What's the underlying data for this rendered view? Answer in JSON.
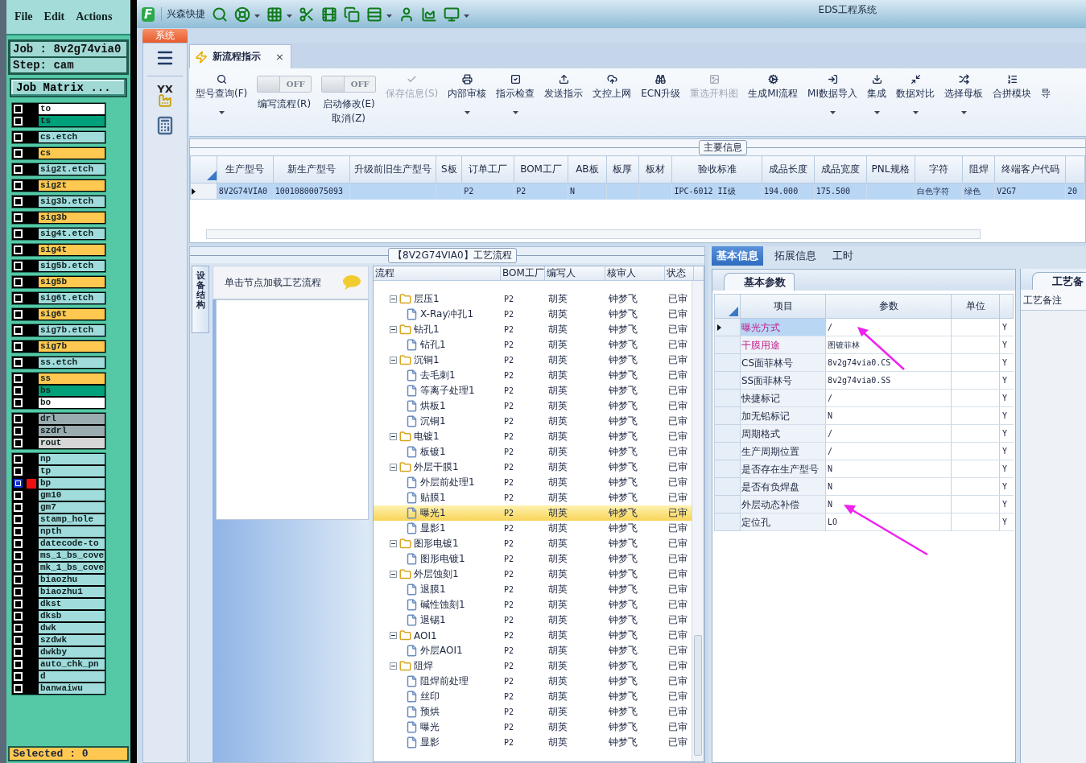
{
  "left_panel": {
    "menu": [
      "File",
      "Edit",
      "Actions"
    ],
    "job": "Job : 8v2g74via0",
    "step": "Step: cam",
    "matrix_button": "Job Matrix ...",
    "layer_groups": [
      {
        "layers": [
          {
            "name": "to",
            "color": "#ffffff",
            "selected": false
          },
          {
            "name": "ts",
            "color": "#00a07a",
            "selected": false
          }
        ]
      },
      {
        "layers": [
          {
            "name": "cs.etch",
            "color": "#a0dcdc",
            "selected": false
          }
        ]
      },
      {
        "layers": [
          {
            "name": "cs",
            "color": "#ffc850",
            "selected": false
          }
        ]
      },
      {
        "layers": [
          {
            "name": "sig2t.etch",
            "color": "#a0dcdc",
            "selected": false
          }
        ]
      },
      {
        "layers": [
          {
            "name": "sig2t",
            "color": "#ffc850",
            "selected": false
          }
        ]
      },
      {
        "layers": [
          {
            "name": "sig3b.etch",
            "color": "#a0dcdc",
            "selected": false
          }
        ]
      },
      {
        "layers": [
          {
            "name": "sig3b",
            "color": "#ffc850",
            "selected": false
          }
        ]
      },
      {
        "layers": [
          {
            "name": "sig4t.etch",
            "color": "#a0dcdc",
            "selected": false
          }
        ]
      },
      {
        "layers": [
          {
            "name": "sig4t",
            "color": "#ffc850",
            "selected": false
          }
        ]
      },
      {
        "layers": [
          {
            "name": "sig5b.etch",
            "color": "#a0dcdc",
            "selected": false
          }
        ]
      },
      {
        "layers": [
          {
            "name": "sig5b",
            "color": "#ffc850",
            "selected": false
          }
        ]
      },
      {
        "layers": [
          {
            "name": "sig6t.etch",
            "color": "#a0dcdc",
            "selected": false
          }
        ]
      },
      {
        "layers": [
          {
            "name": "sig6t",
            "color": "#ffc850",
            "selected": false
          }
        ]
      },
      {
        "layers": [
          {
            "name": "sig7b.etch",
            "color": "#a0dcdc",
            "selected": false
          }
        ]
      },
      {
        "layers": [
          {
            "name": "sig7b",
            "color": "#ffc850",
            "selected": false
          }
        ]
      },
      {
        "layers": [
          {
            "name": "ss.etch",
            "color": "#a0dcdc",
            "selected": false
          }
        ]
      },
      {
        "layers": [
          {
            "name": "ss",
            "color": "#ffc850",
            "selected": false
          },
          {
            "name": "bs",
            "color": "#00a07a",
            "selected": false
          },
          {
            "name": "bo",
            "color": "#ffffff",
            "selected": false
          }
        ]
      },
      {
        "layers": [
          {
            "name": "drl",
            "color": "#9aacb0",
            "selected": false
          },
          {
            "name": "szdrl",
            "color": "#9aacb0",
            "selected": false
          },
          {
            "name": "rout",
            "color": "#d6d6d6",
            "selected": false
          }
        ]
      },
      {
        "layers": [
          {
            "name": "np",
            "color": "#a0dcdc",
            "selected": false
          },
          {
            "name": "tp",
            "color": "#a0dcdc",
            "selected": false
          },
          {
            "name": "bp",
            "color": "#a0dcdc",
            "selected": true
          },
          {
            "name": "gm10",
            "color": "#a0dcdc",
            "selected": false
          },
          {
            "name": "gm7",
            "color": "#a0dcdc",
            "selected": false
          },
          {
            "name": "stamp_hole",
            "color": "#a0dcdc",
            "selected": false
          },
          {
            "name": "npth",
            "color": "#a0dcdc",
            "selected": false
          },
          {
            "name": "datecode-to",
            "color": "#a0dcdc",
            "selected": false
          },
          {
            "name": "ms_1_bs_cove",
            "color": "#a0dcdc",
            "selected": false
          },
          {
            "name": "mk_1_bs_cove",
            "color": "#a0dcdc",
            "selected": false
          },
          {
            "name": "biaozhu",
            "color": "#a0dcdc",
            "selected": false
          },
          {
            "name": "biaozhu1",
            "color": "#a0dcdc",
            "selected": false
          },
          {
            "name": "dkst",
            "color": "#a0dcdc",
            "selected": false
          },
          {
            "name": "dksb",
            "color": "#a0dcdc",
            "selected": false
          },
          {
            "name": "dwk",
            "color": "#a0dcdc",
            "selected": false
          },
          {
            "name": "szdwk",
            "color": "#a0dcdc",
            "selected": false
          },
          {
            "name": "dwkby",
            "color": "#a0dcdc",
            "selected": false
          },
          {
            "name": "auto_chk_pn",
            "color": "#a0dcdc",
            "selected": false
          },
          {
            "name": "d",
            "color": "#a0dcdc",
            "selected": false
          },
          {
            "name": "banwaiwu",
            "color": "#a0dcdc",
            "selected": false
          }
        ]
      }
    ],
    "selected_count": "Selected : 0"
  },
  "app": {
    "logo": "F",
    "quick_label": "兴森快捷",
    "title": "EDS工程系统",
    "system_tab": "系统",
    "sidebar_badge": "YX"
  },
  "doc_tab": {
    "label": "新流程指示",
    "close": "×"
  },
  "ribbon": [
    {
      "kind": "button",
      "label": "型号查询(F)",
      "caret": true,
      "disabled": false
    },
    {
      "kind": "toggle",
      "label": "编写流程(R)",
      "state_text": "OFF",
      "on": false
    },
    {
      "kind": "toggle",
      "label": "启动修改(E)",
      "sublabel": "取消(Z)",
      "state_text": "OFF",
      "on": false
    },
    {
      "kind": "button",
      "label": "保存信息(S)",
      "caret": false,
      "disabled": true
    },
    {
      "kind": "button",
      "label": "内部审核",
      "caret": true,
      "disabled": false
    },
    {
      "kind": "button",
      "label": "指示检查",
      "caret": true,
      "disabled": false
    },
    {
      "kind": "button",
      "label": "发送指示",
      "caret": false,
      "disabled": false
    },
    {
      "kind": "button",
      "label": "文控上网",
      "caret": false,
      "disabled": false
    },
    {
      "kind": "button",
      "label": "ECN升级",
      "caret": false,
      "disabled": false
    },
    {
      "kind": "button",
      "label": "重选开料图",
      "caret": false,
      "disabled": true
    },
    {
      "kind": "button",
      "label": "生成MI流程",
      "caret": false,
      "disabled": false
    },
    {
      "kind": "button",
      "label": "MI数据导入",
      "caret": true,
      "disabled": false
    },
    {
      "kind": "button",
      "label": "集成",
      "caret": true,
      "disabled": false
    },
    {
      "kind": "button",
      "label": "数据对比",
      "caret": true,
      "disabled": false
    },
    {
      "kind": "button",
      "label": "选择母板",
      "caret": true,
      "disabled": false
    },
    {
      "kind": "button",
      "label": "合拼模块",
      "caret": false,
      "disabled": false
    },
    {
      "kind": "button",
      "label": "导",
      "caret": false,
      "disabled": false
    }
  ],
  "main_info": {
    "title": "主要信息",
    "columns": [
      "生产型号",
      "新生产型号",
      "升级前旧生产型号",
      "S板",
      "订单工厂",
      "BOM工厂",
      "AB板",
      "板厚",
      "板材",
      "验收标准",
      "成品长度",
      "成品宽度",
      "PNL规格",
      "字符",
      "阻焊",
      "终端客户代码"
    ],
    "rows": [
      {
        "selected": true,
        "cells": [
          "8V2G74VIA0",
          "10010800075093",
          null,
          null,
          "P2",
          "P2",
          "N",
          null,
          null,
          "IPC-6012 II级",
          "194.000",
          "175.500",
          null,
          "白色字符",
          "绿色",
          "V2G7",
          "20"
        ]
      }
    ]
  },
  "process": {
    "title": "【8V2G74VIA0】工艺流程",
    "side_tab": "设备结构",
    "hint": "单击节点加载工艺流程",
    "columns": [
      "流程",
      "BOM工厂",
      "编写人",
      "核审人",
      "状态"
    ],
    "nodes": [
      {
        "name": "层压1",
        "bom": "P2",
        "writer": "胡英",
        "reviewer": "钟梦飞",
        "status": "已审",
        "expanded": true,
        "selected": false,
        "children": [
          {
            "name": "X-Ray冲孔1",
            "bom": "P2",
            "writer": "胡英",
            "reviewer": "钟梦飞",
            "status": "已审",
            "selected": false
          }
        ]
      },
      {
        "name": "钻孔1",
        "bom": "P2",
        "writer": "胡英",
        "reviewer": "钟梦飞",
        "status": "已审",
        "expanded": true,
        "selected": false,
        "children": [
          {
            "name": "钻孔1",
            "bom": "P2",
            "writer": "胡英",
            "reviewer": "钟梦飞",
            "status": "已审",
            "selected": false
          }
        ]
      },
      {
        "name": "沉铜1",
        "bom": "P2",
        "writer": "胡英",
        "reviewer": "钟梦飞",
        "status": "已审",
        "expanded": true,
        "selected": false,
        "children": [
          {
            "name": "去毛刺1",
            "bom": "P2",
            "writer": "胡英",
            "reviewer": "钟梦飞",
            "status": "已审",
            "selected": false
          },
          {
            "name": "等离子处理1",
            "bom": "P2",
            "writer": "胡英",
            "reviewer": "钟梦飞",
            "status": "已审",
            "selected": false
          },
          {
            "name": "烘板1",
            "bom": "P2",
            "writer": "胡英",
            "reviewer": "钟梦飞",
            "status": "已审",
            "selected": false
          },
          {
            "name": "沉铜1",
            "bom": "P2",
            "writer": "胡英",
            "reviewer": "钟梦飞",
            "status": "已审",
            "selected": false
          }
        ]
      },
      {
        "name": "电镀1",
        "bom": "P2",
        "writer": "胡英",
        "reviewer": "钟梦飞",
        "status": "已审",
        "expanded": true,
        "selected": false,
        "children": [
          {
            "name": "板镀1",
            "bom": "P2",
            "writer": "胡英",
            "reviewer": "钟梦飞",
            "status": "已审",
            "selected": false
          }
        ]
      },
      {
        "name": "外层干膜1",
        "bom": "P2",
        "writer": "胡英",
        "reviewer": "钟梦飞",
        "status": "已审",
        "expanded": true,
        "selected": false,
        "children": [
          {
            "name": "外层前处理1",
            "bom": "P2",
            "writer": "胡英",
            "reviewer": "钟梦飞",
            "status": "已审",
            "selected": false
          },
          {
            "name": "贴膜1",
            "bom": "P2",
            "writer": "胡英",
            "reviewer": "钟梦飞",
            "status": "已审",
            "selected": false
          },
          {
            "name": "曝光1",
            "bom": "P2",
            "writer": "胡英",
            "reviewer": "钟梦飞",
            "status": "已审",
            "selected": true
          },
          {
            "name": "显影1",
            "bom": "P2",
            "writer": "胡英",
            "reviewer": "钟梦飞",
            "status": "已审",
            "selected": false
          }
        ]
      },
      {
        "name": "图形电镀1",
        "bom": "P2",
        "writer": "胡英",
        "reviewer": "钟梦飞",
        "status": "已审",
        "expanded": true,
        "selected": false,
        "children": [
          {
            "name": "图形电镀1",
            "bom": "P2",
            "writer": "胡英",
            "reviewer": "钟梦飞",
            "status": "已审",
            "selected": false
          }
        ]
      },
      {
        "name": "外层蚀刻1",
        "bom": "P2",
        "writer": "胡英",
        "reviewer": "钟梦飞",
        "status": "已审",
        "expanded": true,
        "selected": false,
        "children": [
          {
            "name": "退膜1",
            "bom": "P2",
            "writer": "胡英",
            "reviewer": "钟梦飞",
            "status": "已审",
            "selected": false
          },
          {
            "name": "碱性蚀刻1",
            "bom": "P2",
            "writer": "胡英",
            "reviewer": "钟梦飞",
            "status": "已审",
            "selected": false
          },
          {
            "name": "退锡1",
            "bom": "P2",
            "writer": "胡英",
            "reviewer": "钟梦飞",
            "status": "已审",
            "selected": false
          }
        ]
      },
      {
        "name": "AOI1",
        "bom": "P2",
        "writer": "胡英",
        "reviewer": "钟梦飞",
        "status": "已审",
        "expanded": true,
        "selected": false,
        "children": [
          {
            "name": "外层AOI1",
            "bom": "P2",
            "writer": "胡英",
            "reviewer": "钟梦飞",
            "status": "已审",
            "selected": false
          }
        ]
      },
      {
        "name": "阻焊",
        "bom": "P2",
        "writer": "胡英",
        "reviewer": "钟梦飞",
        "status": "已审",
        "expanded": true,
        "selected": false,
        "children": [
          {
            "name": "阻焊前处理",
            "bom": "P2",
            "writer": "胡英",
            "reviewer": "钟梦飞",
            "status": "已审",
            "selected": false
          },
          {
            "name": "丝印",
            "bom": "P2",
            "writer": "胡英",
            "reviewer": "钟梦飞",
            "status": "已审",
            "selected": false
          },
          {
            "name": "预烘",
            "bom": "P2",
            "writer": "胡英",
            "reviewer": "钟梦飞",
            "status": "已审",
            "selected": false
          },
          {
            "name": "曝光",
            "bom": "P2",
            "writer": "胡英",
            "reviewer": "钟梦飞",
            "status": "已审",
            "selected": false
          },
          {
            "name": "显影",
            "bom": "P2",
            "writer": "胡英",
            "reviewer": "钟梦飞",
            "status": "已审",
            "selected": false
          }
        ]
      }
    ]
  },
  "details": {
    "tabs": [
      {
        "label": "基本信息",
        "selected": true
      },
      {
        "label": "拓展信息",
        "selected": false
      },
      {
        "label": "工时",
        "selected": false
      }
    ],
    "subtab": "基本参数",
    "columns": [
      "项目",
      "参数",
      "单位"
    ],
    "rows": [
      {
        "item": "曝光方式",
        "value": "/",
        "flag": "Y",
        "highlight": true,
        "selected": true
      },
      {
        "item": "干膜用途",
        "value": "图镀菲林",
        "flag": "Y",
        "highlight": true,
        "selected": false
      },
      {
        "item": "CS面菲林号",
        "value": "8v2g74via0.CS",
        "flag": "Y",
        "highlight": false,
        "selected": false
      },
      {
        "item": "SS面菲林号",
        "value": "8v2g74via0.SS",
        "flag": "Y",
        "highlight": false,
        "selected": false
      },
      {
        "item": "快捷标记",
        "value": "/",
        "flag": "Y",
        "highlight": false,
        "selected": false
      },
      {
        "item": "加无铅标记",
        "value": "N",
        "flag": "Y",
        "highlight": false,
        "selected": false
      },
      {
        "item": "周期格式",
        "value": "/",
        "flag": "Y",
        "highlight": false,
        "selected": false
      },
      {
        "item": "生产周期位置",
        "value": "/",
        "flag": "Y",
        "highlight": false,
        "selected": false
      },
      {
        "item": "是否存在生产型号",
        "value": "N",
        "flag": "Y",
        "highlight": false,
        "selected": false
      },
      {
        "item": "是否有负焊盘",
        "value": "N",
        "flag": "Y",
        "highlight": false,
        "selected": false
      },
      {
        "item": "外层动态补偿",
        "value": "N",
        "flag": "Y",
        "highlight": false,
        "selected": false
      },
      {
        "item": "定位孔",
        "value": "LO",
        "flag": "Y",
        "highlight": false,
        "selected": false
      }
    ],
    "notes_tab": "工艺备",
    "notes_label": "工艺备注"
  }
}
